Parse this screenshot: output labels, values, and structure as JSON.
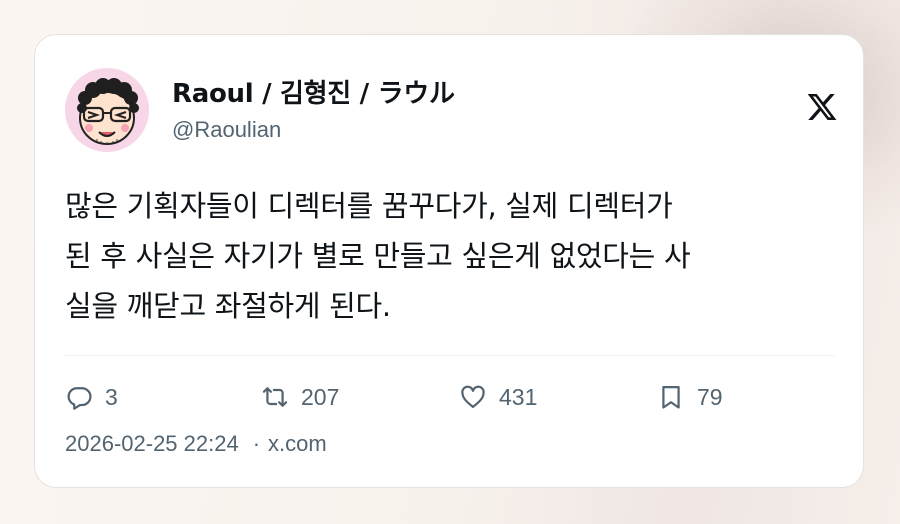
{
  "author": {
    "name": "Raoul / 김형진 / ラウル",
    "handle": "@Raoulian"
  },
  "tweet": {
    "text": "많은 기획자들이 디렉터를 꿈꾸다가, 실제 디렉터가\n된 후 사실은 자기가 별로 만들고 싶은게 없었다는 사\n실을 깨닫고 좌절하게 된다."
  },
  "actions": {
    "replies": "3",
    "retweets": "207",
    "likes": "431",
    "bookmarks": "79"
  },
  "meta": {
    "timestamp": "2026-02-25 22:24",
    "separator": "·",
    "source": "x.com"
  },
  "colors": {
    "text_primary": "#0f1419",
    "text_secondary": "#536471",
    "card_background": "#ffffff",
    "avatar_background": "#f7d6e8"
  },
  "icons": [
    "x-logo-icon",
    "reply-icon",
    "retweet-icon",
    "like-icon",
    "bookmark-icon"
  ]
}
